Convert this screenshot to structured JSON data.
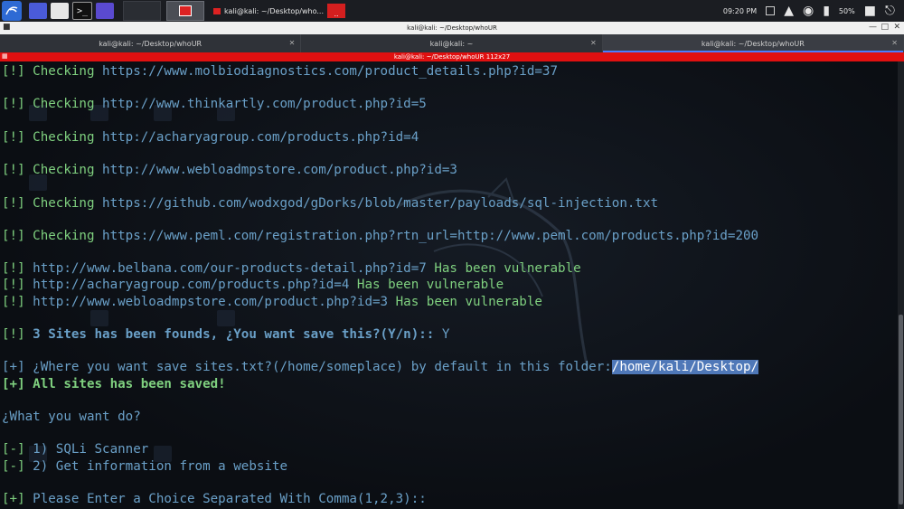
{
  "taskbar": {
    "task_title": "kali@kali: ~/Desktop/who...",
    "clock": "09:20 PM",
    "battery": "50%"
  },
  "window": {
    "title": "kali@kali: ~/Desktop/whoUR"
  },
  "tabs": [
    {
      "label": "kali@kali: ~/Desktop/whoUR",
      "active": false
    },
    {
      "label": "kali@kali: ~",
      "active": false
    },
    {
      "label": "kali@kali: ~/Desktop/whoUR",
      "active": true
    }
  ],
  "infobar": {
    "text": "kali@kali: ~/Desktop/whoUR 112x27"
  },
  "terminal": {
    "lines": [
      [
        {
          "t": "[!] Checking ",
          "c": "green"
        },
        {
          "t": "https://www.molbiodiagnostics.com/product_details.php?id=37",
          "c": "url"
        }
      ],
      [],
      [
        {
          "t": "[!] Checking ",
          "c": "green"
        },
        {
          "t": "http://www.thinkartly.com/product.php?id=5",
          "c": "url"
        }
      ],
      [],
      [
        {
          "t": "[!] Checking ",
          "c": "green"
        },
        {
          "t": "http://acharyagroup.com/products.php?id=4",
          "c": "url"
        }
      ],
      [],
      [
        {
          "t": "[!] Checking ",
          "c": "green"
        },
        {
          "t": "http://www.webloadmpstore.com/product.php?id=3",
          "c": "url"
        }
      ],
      [],
      [
        {
          "t": "[!] Checking ",
          "c": "green"
        },
        {
          "t": "https://github.com/wodxgod/gDorks/blob/master/payloads/sql-injection.txt",
          "c": "url"
        }
      ],
      [],
      [
        {
          "t": "[!] Checking ",
          "c": "green"
        },
        {
          "t": "https://www.peml.com/registration.php?rtn_url=http://www.peml.com/products.php?id=200",
          "c": "url"
        }
      ],
      [],
      [
        {
          "t": "[!] ",
          "c": "green"
        },
        {
          "t": "http://www.belbana.com/our-products-detail.php?id=7",
          "c": "url"
        },
        {
          "t": " Has been vulnerable",
          "c": "green"
        }
      ],
      [
        {
          "t": "[!] ",
          "c": "green"
        },
        {
          "t": "http://acharyagroup.com/products.php?id=4",
          "c": "url"
        },
        {
          "t": " Has been vulnerable",
          "c": "green"
        }
      ],
      [
        {
          "t": "[!] ",
          "c": "green"
        },
        {
          "t": "http://www.webloadmpstore.com/product.php?id=3",
          "c": "url"
        },
        {
          "t": " Has been vulnerable",
          "c": "green"
        }
      ],
      [],
      [
        {
          "t": "[!] ",
          "c": "green"
        },
        {
          "t": "3 Sites has been founds, ¿You want save this?(Y/n):: ",
          "c": "blue",
          "b": true
        },
        {
          "t": "Y",
          "c": "blue"
        }
      ],
      [],
      [
        {
          "t": "[+] ¿Where you want save sites.txt?(/home/someplace) by default in this folder:",
          "c": "blue"
        },
        {
          "t": "/home/kali/Desktop/",
          "c": "sel"
        }
      ],
      [
        {
          "t": "[+] All sites has been saved!",
          "c": "green",
          "b": true
        }
      ],
      [],
      [
        {
          "t": "¿What you want do?",
          "c": "blue"
        }
      ],
      [],
      [
        {
          "t": "[-] ",
          "c": "green"
        },
        {
          "t": "1) SQLi Scanner",
          "c": "blue"
        }
      ],
      [
        {
          "t": "[-] ",
          "c": "green"
        },
        {
          "t": "2) Get information from a website",
          "c": "blue"
        }
      ],
      [],
      [
        {
          "t": "[+] ",
          "c": "green"
        },
        {
          "t": "Please Enter a Choice Separated With Comma(1,2,3)::",
          "c": "blue"
        }
      ]
    ]
  },
  "colors": {
    "prompt_green": "#7fd07f",
    "url_blue": "#6aa0c8",
    "selection": "#4f78b8",
    "infobar_red": "#e01010",
    "tab_accent": "#4a7dff"
  }
}
